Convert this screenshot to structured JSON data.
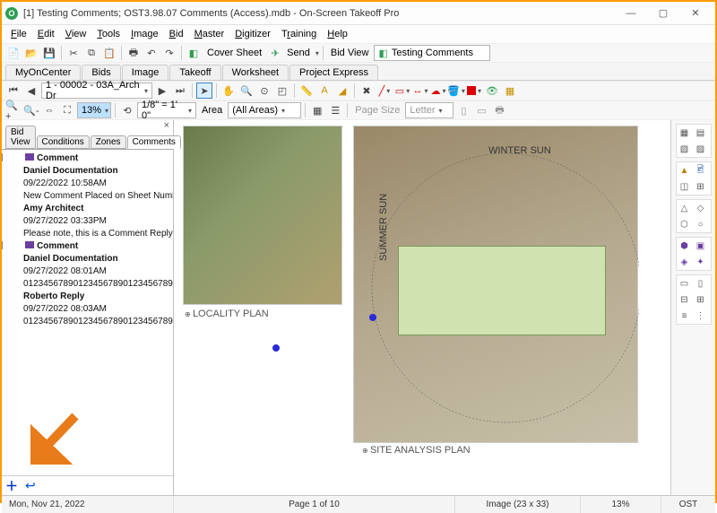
{
  "window": {
    "title": "[1] Testing Comments; OST3.98.07 Comments (Access).mdb - On-Screen Takeoff Pro"
  },
  "menu": {
    "file": "File",
    "edit": "Edit",
    "view": "View",
    "tools": "Tools",
    "image": "Image",
    "bid": "Bid",
    "master": "Master",
    "digitizer": "Digitizer",
    "training": "Training",
    "help": "Help"
  },
  "toolbar1": {
    "cover_sheet": "Cover Sheet",
    "send": "Send",
    "bid_view": "Bid View",
    "testing": "Testing Comments"
  },
  "doc_tabs": {
    "myoncenter": "MyOnCenter",
    "bids": "Bids",
    "image": "Image",
    "takeoff": "Takeoff",
    "worksheet": "Worksheet",
    "project_express": "Project Express"
  },
  "toolbar2": {
    "sheet_dd": "1 - 00002 - 03A_Arch Dr",
    "zoom": "13%"
  },
  "toolbar3": {
    "scale": "1/8\" = 1' 0\"",
    "area_lbl": "Area",
    "area_dd": "(All Areas)",
    "page_size": "Page Size",
    "letter": "Letter"
  },
  "side_tabs": {
    "bid_view": "Bid View",
    "conditions": "Conditions",
    "zones": "Zones",
    "comments": "Comments"
  },
  "comments": [
    {
      "head": "Comment",
      "author": "Daniel Documentation",
      "date": "09/22/2022 10:58AM",
      "body": "New Comment Placed on Sheet Number",
      "reply_author": "Amy Architect",
      "reply_date": "09/27/2022 03:33PM",
      "reply_body": "Please note, this is a Comment Reply"
    },
    {
      "head": "Comment",
      "author": "Daniel Documentation",
      "date": "09/27/2022 08:01AM",
      "body": "01234567890123456789012345678901234...",
      "reply_author": "Roberto Reply",
      "reply_date": "09/27/2022 08:03AM",
      "reply_body": "01234567890123456789012345678901234..."
    }
  ],
  "canvas": {
    "locality": "LOCALITY PLAN",
    "site": "SITE ANALYSIS PLAN",
    "winter": "WINTER SUN",
    "summer": "SUMMER SUN"
  },
  "status": {
    "date": "Mon, Nov 21, 2022",
    "page": "Page 1 of 10",
    "image": "Image (23 x 33)",
    "zoom": "13%",
    "mode": "OST"
  }
}
